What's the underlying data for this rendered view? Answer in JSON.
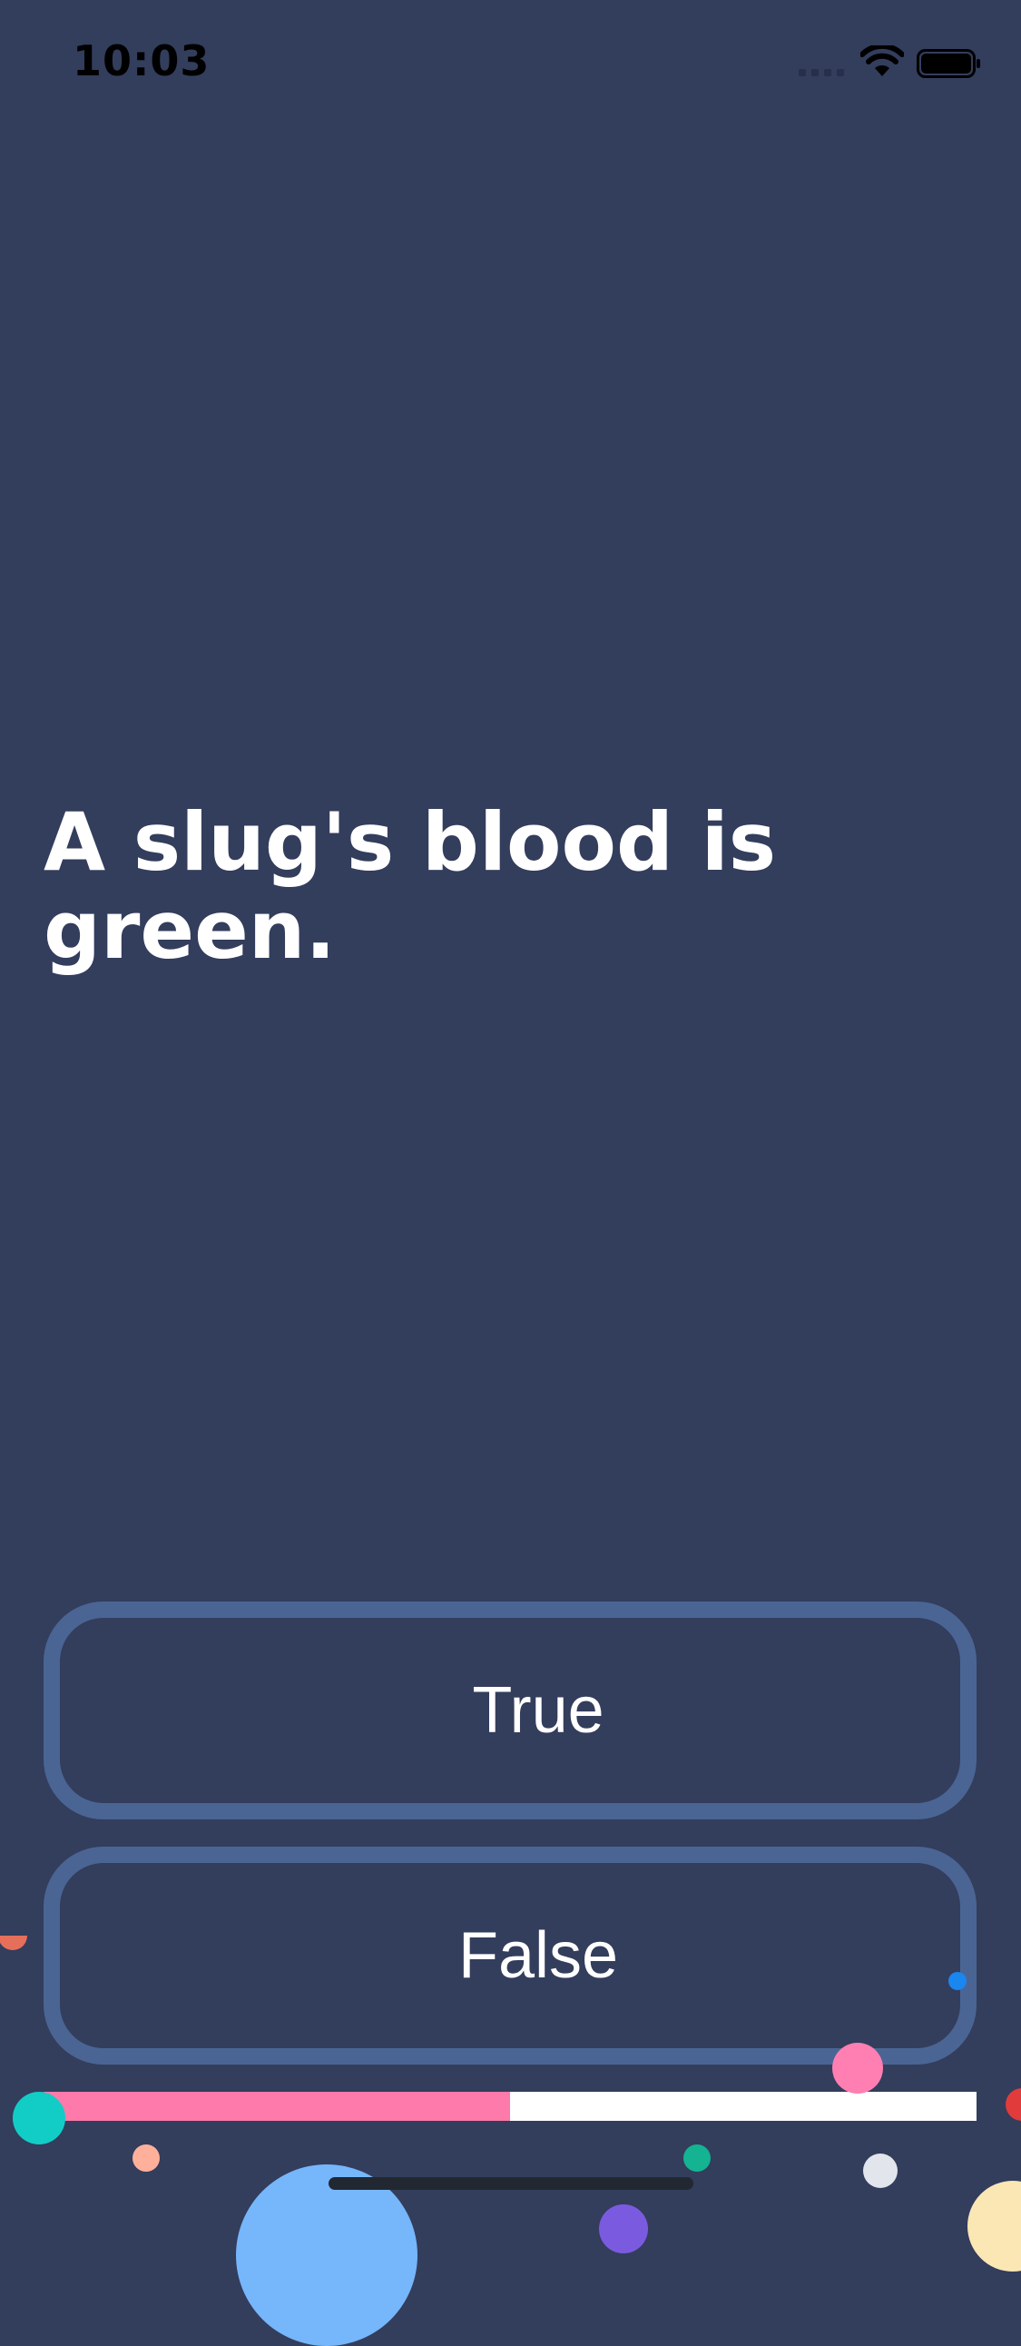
{
  "status_bar": {
    "time": "10:03",
    "icons": [
      "cellular-signal-icon",
      "wifi-icon",
      "battery-icon"
    ]
  },
  "quiz": {
    "question": "A slug's blood is green.",
    "answers": {
      "true_label": "True",
      "false_label": "False"
    },
    "progress": 0.5
  },
  "colors": {
    "background": "#333d5c",
    "button_border": "#4a6594",
    "progress_fill": "#fe7aaa",
    "progress_track": "#ffffff",
    "text": "#ffffff"
  }
}
